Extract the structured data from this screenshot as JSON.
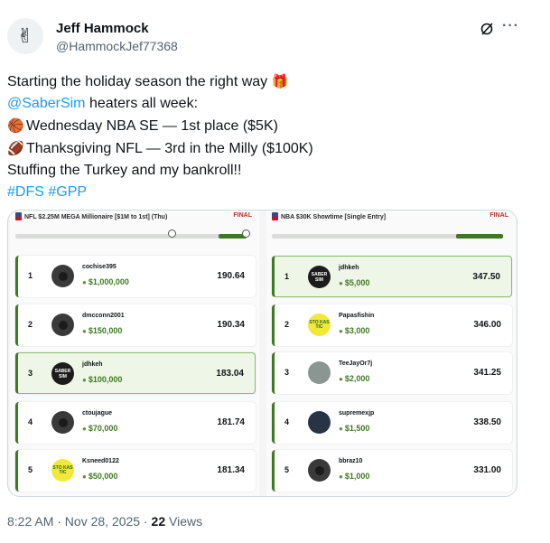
{
  "author": {
    "name": "Jeff Hammock",
    "handle": "@HammockJef77368",
    "avatar_emoji": "✌"
  },
  "tweet": {
    "line1": "Starting the holiday season the right way",
    "line1_emoji": "🎁",
    "mention": "@SaberSim",
    "line2_rest": " heaters all week:",
    "basketball_emoji": "🏀",
    "line3": "Wednesday NBA SE — 1st place ($5K)",
    "football_emoji": "🏈",
    "line4": "Thanksgiving NFL — 3rd in the Milly ($100K)",
    "line5": "Stuffing the Turkey and my bankroll!!",
    "hashtag1": "#DFS",
    "hashtag2": "#GPP"
  },
  "left_panel": {
    "title": "NFL $2.25M MEGA Millionaire [$1M to 1st] (Thu)",
    "status": "FINAL",
    "entries": [
      {
        "rank": "1",
        "user": "cochise395",
        "prize": "$1,000,000",
        "score": "190.64"
      },
      {
        "rank": "2",
        "user": "dmcconn2001",
        "prize": "$150,000",
        "score": "190.34"
      },
      {
        "rank": "3",
        "user": "jdhkeh",
        "prize": "$100,000",
        "score": "183.04",
        "avatar_text": "SABER SIM"
      },
      {
        "rank": "4",
        "user": "ctoujague",
        "prize": "$70,000",
        "score": "181.74"
      },
      {
        "rank": "5",
        "user": "Ksneed0122",
        "prize": "$50,000",
        "score": "181.34",
        "avatar_text": "STO KAS TIC"
      }
    ]
  },
  "right_panel": {
    "title": "NBA $30K Showtime [Single Entry]",
    "status": "FINAL",
    "entries": [
      {
        "rank": "1",
        "user": "jdhkeh",
        "prize": "$5,000",
        "score": "347.50",
        "avatar_text": "SABER SIM"
      },
      {
        "rank": "2",
        "user": "Papasfishin",
        "prize": "$3,000",
        "score": "346.00",
        "avatar_text": "STO KAS TIC"
      },
      {
        "rank": "3",
        "user": "TeeJayOr7j",
        "prize": "$2,000",
        "score": "341.25"
      },
      {
        "rank": "4",
        "user": "supremexjp",
        "prize": "$1,500",
        "score": "338.50"
      },
      {
        "rank": "5",
        "user": "bbraz10",
        "prize": "$1,000",
        "score": "331.00"
      }
    ]
  },
  "footer": {
    "time": "8:22 AM · Nov 28, 2025 · ",
    "views_count": "22",
    "views_label": " Views"
  },
  "colors": {
    "link": "#1d9bf0",
    "accent_green": "#3d7a21",
    "final_red": "#b8322c"
  }
}
